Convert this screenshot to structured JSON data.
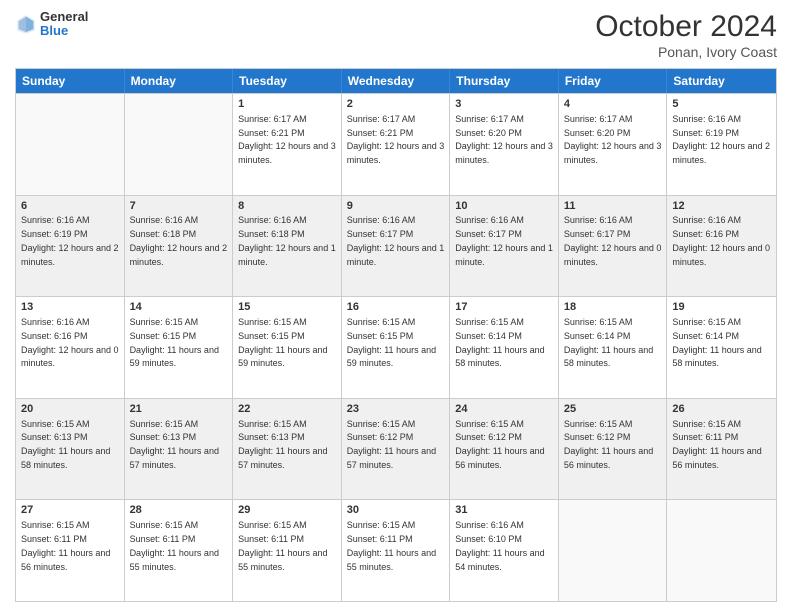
{
  "header": {
    "logo_general": "General",
    "logo_blue": "Blue",
    "month_title": "October 2024",
    "subtitle": "Ponan, Ivory Coast"
  },
  "days_of_week": [
    "Sunday",
    "Monday",
    "Tuesday",
    "Wednesday",
    "Thursday",
    "Friday",
    "Saturday"
  ],
  "weeks": [
    [
      {
        "day": "",
        "info": "",
        "shaded": false,
        "empty": true
      },
      {
        "day": "",
        "info": "",
        "shaded": false,
        "empty": true
      },
      {
        "day": "1",
        "info": "Sunrise: 6:17 AM\nSunset: 6:21 PM\nDaylight: 12 hours and 3 minutes.",
        "shaded": false,
        "empty": false
      },
      {
        "day": "2",
        "info": "Sunrise: 6:17 AM\nSunset: 6:21 PM\nDaylight: 12 hours and 3 minutes.",
        "shaded": false,
        "empty": false
      },
      {
        "day": "3",
        "info": "Sunrise: 6:17 AM\nSunset: 6:20 PM\nDaylight: 12 hours and 3 minutes.",
        "shaded": false,
        "empty": false
      },
      {
        "day": "4",
        "info": "Sunrise: 6:17 AM\nSunset: 6:20 PM\nDaylight: 12 hours and 3 minutes.",
        "shaded": false,
        "empty": false
      },
      {
        "day": "5",
        "info": "Sunrise: 6:16 AM\nSunset: 6:19 PM\nDaylight: 12 hours and 2 minutes.",
        "shaded": false,
        "empty": false
      }
    ],
    [
      {
        "day": "6",
        "info": "Sunrise: 6:16 AM\nSunset: 6:19 PM\nDaylight: 12 hours and 2 minutes.",
        "shaded": true,
        "empty": false
      },
      {
        "day": "7",
        "info": "Sunrise: 6:16 AM\nSunset: 6:18 PM\nDaylight: 12 hours and 2 minutes.",
        "shaded": true,
        "empty": false
      },
      {
        "day": "8",
        "info": "Sunrise: 6:16 AM\nSunset: 6:18 PM\nDaylight: 12 hours and 1 minute.",
        "shaded": true,
        "empty": false
      },
      {
        "day": "9",
        "info": "Sunrise: 6:16 AM\nSunset: 6:17 PM\nDaylight: 12 hours and 1 minute.",
        "shaded": true,
        "empty": false
      },
      {
        "day": "10",
        "info": "Sunrise: 6:16 AM\nSunset: 6:17 PM\nDaylight: 12 hours and 1 minute.",
        "shaded": true,
        "empty": false
      },
      {
        "day": "11",
        "info": "Sunrise: 6:16 AM\nSunset: 6:17 PM\nDaylight: 12 hours and 0 minutes.",
        "shaded": true,
        "empty": false
      },
      {
        "day": "12",
        "info": "Sunrise: 6:16 AM\nSunset: 6:16 PM\nDaylight: 12 hours and 0 minutes.",
        "shaded": true,
        "empty": false
      }
    ],
    [
      {
        "day": "13",
        "info": "Sunrise: 6:16 AM\nSunset: 6:16 PM\nDaylight: 12 hours and 0 minutes.",
        "shaded": false,
        "empty": false
      },
      {
        "day": "14",
        "info": "Sunrise: 6:15 AM\nSunset: 6:15 PM\nDaylight: 11 hours and 59 minutes.",
        "shaded": false,
        "empty": false
      },
      {
        "day": "15",
        "info": "Sunrise: 6:15 AM\nSunset: 6:15 PM\nDaylight: 11 hours and 59 minutes.",
        "shaded": false,
        "empty": false
      },
      {
        "day": "16",
        "info": "Sunrise: 6:15 AM\nSunset: 6:15 PM\nDaylight: 11 hours and 59 minutes.",
        "shaded": false,
        "empty": false
      },
      {
        "day": "17",
        "info": "Sunrise: 6:15 AM\nSunset: 6:14 PM\nDaylight: 11 hours and 58 minutes.",
        "shaded": false,
        "empty": false
      },
      {
        "day": "18",
        "info": "Sunrise: 6:15 AM\nSunset: 6:14 PM\nDaylight: 11 hours and 58 minutes.",
        "shaded": false,
        "empty": false
      },
      {
        "day": "19",
        "info": "Sunrise: 6:15 AM\nSunset: 6:14 PM\nDaylight: 11 hours and 58 minutes.",
        "shaded": false,
        "empty": false
      }
    ],
    [
      {
        "day": "20",
        "info": "Sunrise: 6:15 AM\nSunset: 6:13 PM\nDaylight: 11 hours and 58 minutes.",
        "shaded": true,
        "empty": false
      },
      {
        "day": "21",
        "info": "Sunrise: 6:15 AM\nSunset: 6:13 PM\nDaylight: 11 hours and 57 minutes.",
        "shaded": true,
        "empty": false
      },
      {
        "day": "22",
        "info": "Sunrise: 6:15 AM\nSunset: 6:13 PM\nDaylight: 11 hours and 57 minutes.",
        "shaded": true,
        "empty": false
      },
      {
        "day": "23",
        "info": "Sunrise: 6:15 AM\nSunset: 6:12 PM\nDaylight: 11 hours and 57 minutes.",
        "shaded": true,
        "empty": false
      },
      {
        "day": "24",
        "info": "Sunrise: 6:15 AM\nSunset: 6:12 PM\nDaylight: 11 hours and 56 minutes.",
        "shaded": true,
        "empty": false
      },
      {
        "day": "25",
        "info": "Sunrise: 6:15 AM\nSunset: 6:12 PM\nDaylight: 11 hours and 56 minutes.",
        "shaded": true,
        "empty": false
      },
      {
        "day": "26",
        "info": "Sunrise: 6:15 AM\nSunset: 6:11 PM\nDaylight: 11 hours and 56 minutes.",
        "shaded": true,
        "empty": false
      }
    ],
    [
      {
        "day": "27",
        "info": "Sunrise: 6:15 AM\nSunset: 6:11 PM\nDaylight: 11 hours and 56 minutes.",
        "shaded": false,
        "empty": false
      },
      {
        "day": "28",
        "info": "Sunrise: 6:15 AM\nSunset: 6:11 PM\nDaylight: 11 hours and 55 minutes.",
        "shaded": false,
        "empty": false
      },
      {
        "day": "29",
        "info": "Sunrise: 6:15 AM\nSunset: 6:11 PM\nDaylight: 11 hours and 55 minutes.",
        "shaded": false,
        "empty": false
      },
      {
        "day": "30",
        "info": "Sunrise: 6:15 AM\nSunset: 6:11 PM\nDaylight: 11 hours and 55 minutes.",
        "shaded": false,
        "empty": false
      },
      {
        "day": "31",
        "info": "Sunrise: 6:16 AM\nSunset: 6:10 PM\nDaylight: 11 hours and 54 minutes.",
        "shaded": false,
        "empty": false
      },
      {
        "day": "",
        "info": "",
        "shaded": false,
        "empty": true
      },
      {
        "day": "",
        "info": "",
        "shaded": false,
        "empty": true
      }
    ]
  ]
}
